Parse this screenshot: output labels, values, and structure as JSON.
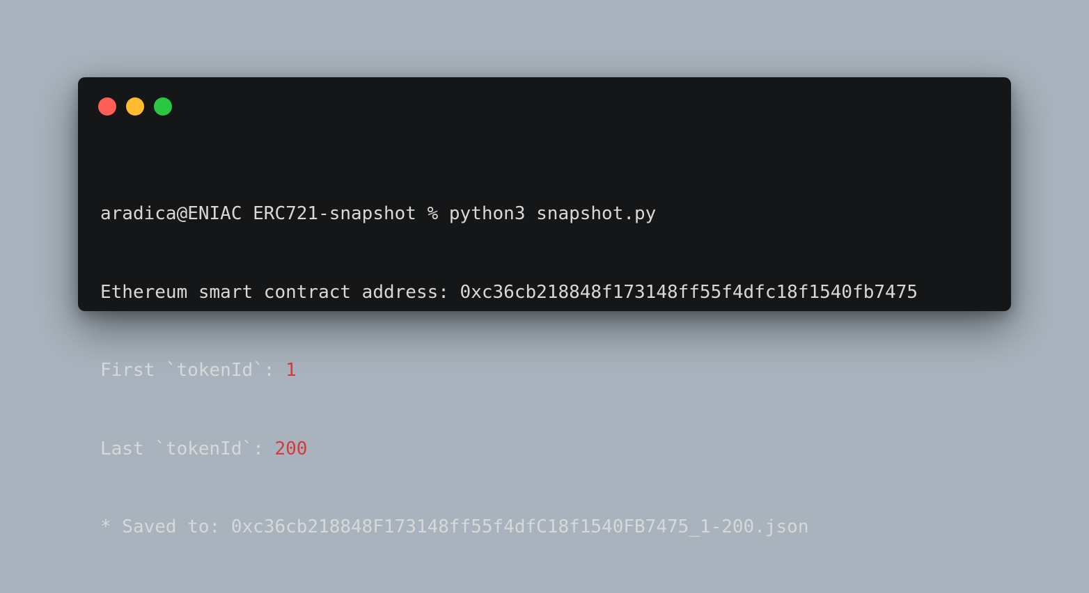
{
  "terminal": {
    "controls": {
      "close_icon": "close-icon",
      "minimize_icon": "minimize-icon",
      "zoom_icon": "zoom-icon"
    },
    "lines": [
      {
        "text": "aradica@ENIAC ERC721-snapshot % python3 snapshot.py"
      },
      {
        "text": "Ethereum smart contract address: 0xc36cb218848f173148ff55f4dfc18f1540fb7475"
      },
      {
        "prefix": "First `tokenId`: ",
        "value": "1"
      },
      {
        "prefix": "Last `tokenId`: ",
        "value": "200"
      },
      {
        "text": "* Saved to: 0xc36cb218848F173148ff55f4dfC18f1540FB7475_1-200.json"
      }
    ]
  },
  "colors": {
    "background": "#a8b3bd",
    "terminal_bg": "#151618",
    "text": "#d8d8d8",
    "highlight": "#d8383a",
    "close": "#ff5f57",
    "minimize": "#febc2e",
    "zoom": "#28c840"
  }
}
